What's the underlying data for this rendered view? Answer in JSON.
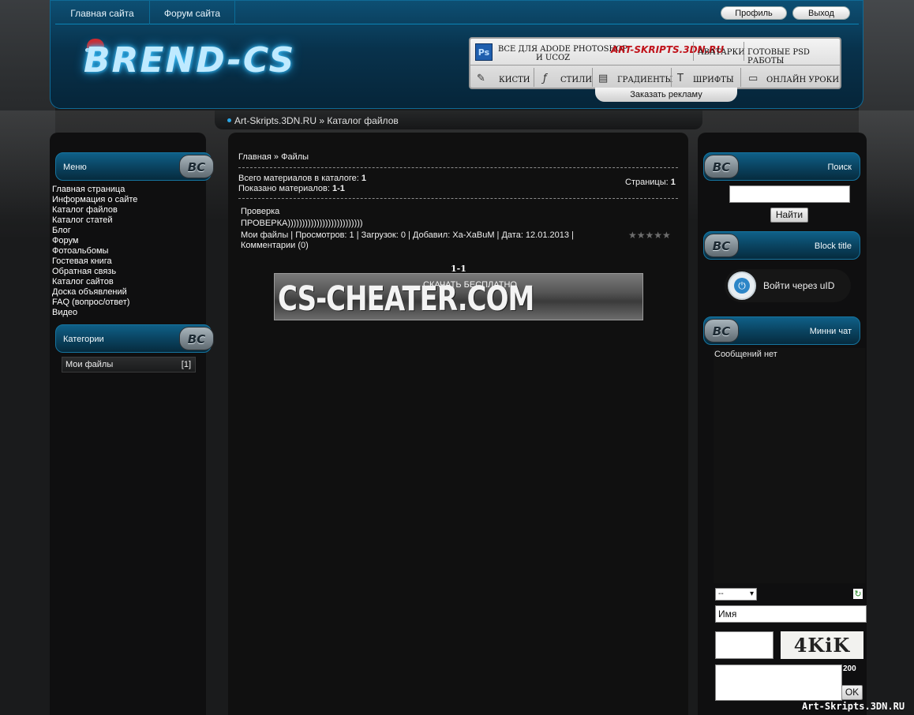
{
  "top_nav": {
    "home": "Главная сайта",
    "forum": "Форум сайта",
    "profile": "Профиль",
    "logout": "Выход"
  },
  "logo": {
    "text": "BREND-CS"
  },
  "ad": {
    "ps_icon": "Ps",
    "all_for": "Все для Adode Photoshop",
    "and_ucoz": "и uCoz",
    "brand": "ART-SKRIPTS.3DN.RU",
    "avatars": "Аватарки",
    "psd": "Готовые PSD работы",
    "brushes": "Кисти",
    "styles": "Стили",
    "gradients": "Градиенты",
    "fonts": "Шрифты",
    "lessons": "Онлайн уроки",
    "order": "Заказать рекламу"
  },
  "breadcrumb": {
    "text": "Art-Skripts.3DN.RU » Каталог файлов"
  },
  "left": {
    "menu_title": "Меню",
    "badge": "BC",
    "menu_items": [
      "Главная страница",
      "Информация о сайте",
      "Каталог файлов",
      "Каталог статей",
      "Блог",
      "Форум",
      "Фотоальбомы",
      "Гостевая книга",
      "Обратная связь",
      "Каталог сайтов",
      "Доска объявлений",
      "FAQ (вопрос/ответ)",
      "Видео"
    ],
    "categories_title": "Категории",
    "category": {
      "name": "Мои файлы",
      "count": "[1]"
    }
  },
  "main": {
    "crumbs": "Главная » Файлы",
    "total_label": "Всего материалов в каталоге:",
    "total_value": "1",
    "shown_label": "Показано материалов:",
    "shown_value": "1-1",
    "pages_label": "Страницы:",
    "pages_value": "1",
    "item_title": "Проверка",
    "item_text": "ПРОВЕРКА))))))))))))))))))))))))))",
    "item_meta": "Мои файлы | Просмотров: 1 | Загрузок: 0 | Добавил: Xa-XaBuM | Дата: 12.01.2013 |",
    "item_comments": "Комментарии (0)",
    "rating_stars": "★★★★★",
    "pager": "1-1",
    "banner_big": "CS-CHEATER.COM",
    "banner_small": "СКАЧАТЬ БЕСПЛАТНО"
  },
  "right": {
    "search_title": "Поиск",
    "search_button": "Найти",
    "block_title": "Block title",
    "uid_login": "Войти через uID",
    "chat_title": "Минни чат",
    "chat_empty": "Сообщений нет",
    "chat_select": "--",
    "name_placeholder": "Имя",
    "captcha": "4KiK",
    "char_limit": "200",
    "ok_button": "OK"
  },
  "footer": {
    "watermark": "Art-Skripts.3DN.RU"
  }
}
